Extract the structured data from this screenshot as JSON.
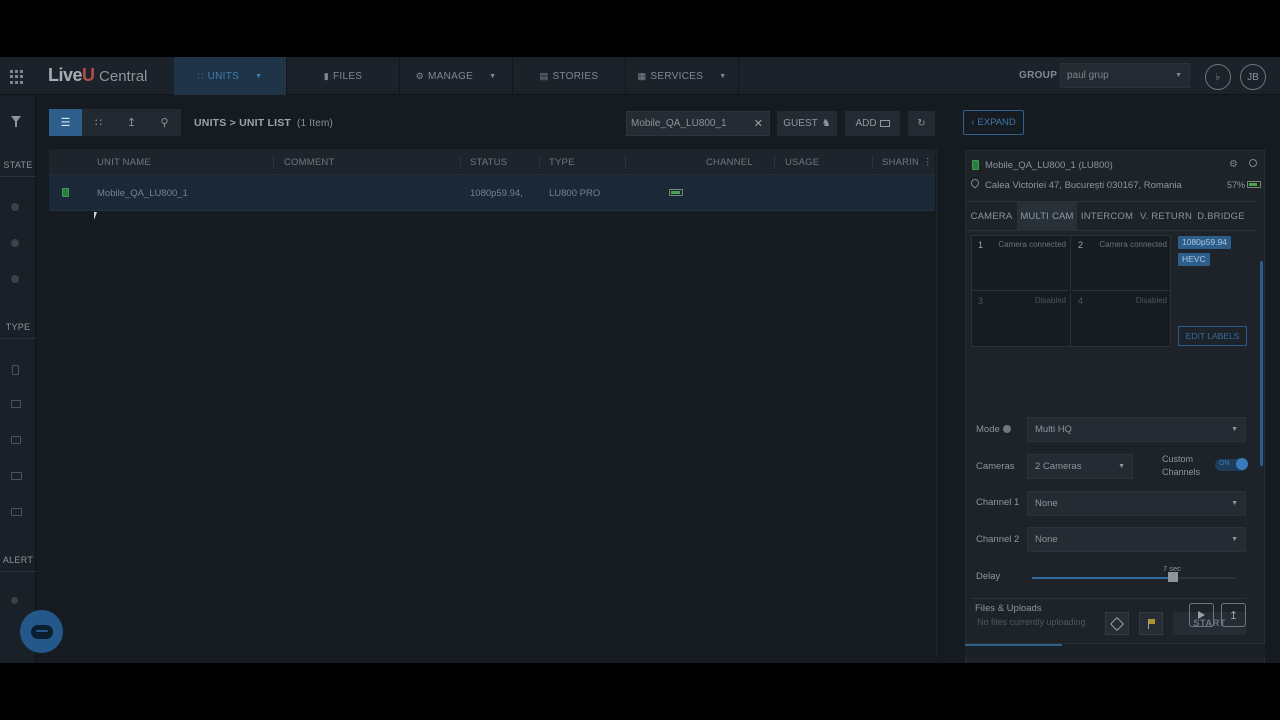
{
  "nav": {
    "logo_live": "Live",
    "logo_u": "U",
    "logo_central": "Central",
    "tabs": [
      {
        "label": "UNITS",
        "icon": "grid-icon"
      },
      {
        "label": "FILES",
        "icon": "file-icon"
      },
      {
        "label": "MANAGE",
        "icon": "gear-icon"
      },
      {
        "label": "STORIES",
        "icon": "stories-icon"
      },
      {
        "label": "SERVICES",
        "icon": "services-icon"
      }
    ],
    "group_label": "GROUP",
    "group_value": "paul grup",
    "user_initials": "JB"
  },
  "rail": {
    "state_label": "STATE",
    "type_label": "TYPE",
    "alert_label": "ALERT"
  },
  "toolbar": {
    "breadcrumb": "UNITS > UNIT LIST",
    "count": "(1 Item)",
    "search_value": "Mobile_QA_LU800_1",
    "guest_label": "GUEST",
    "add_label": "ADD"
  },
  "table": {
    "columns": [
      "UNIT NAME",
      "COMMENT",
      "STATUS",
      "TYPE",
      "CHANNEL",
      "USAGE",
      "SHARING"
    ],
    "rows": [
      {
        "name": "Mobile_QA_LU800_1",
        "comment": "",
        "status": "1080p59.94,",
        "type": "LU800 PRO"
      }
    ]
  },
  "panel": {
    "expand_label": "EXPAND",
    "unit_title": "Mobile_QA_LU800_1 (LU800)",
    "address": "Calea Victoriei 47, București 030167, Romania",
    "battery": "57%",
    "tabs": [
      "CAMERA",
      "MULTI CAM",
      "INTERCOM",
      "V. RETURN",
      "D.BRIDGE"
    ],
    "cams": [
      {
        "num": "1",
        "status": "Camera connected"
      },
      {
        "num": "2",
        "status": "Camera connected"
      },
      {
        "num": "3",
        "status": "Disabled"
      },
      {
        "num": "4",
        "status": "Disabled"
      }
    ],
    "tag_resolution": "1080p59.94",
    "tag_codec": "HEVC",
    "edit_labels": "EDIT LABELS",
    "mode_label": "Mode",
    "mode_value": "Multi HQ",
    "cameras_label": "Cameras",
    "cameras_value": "2 Cameras",
    "custom_channels_label": "Custom Channels",
    "toggle_on": "ON",
    "channel1_label": "Channel 1",
    "channel1_value": "None",
    "channel2_label": "Channel 2",
    "channel2_value": "None",
    "delay_label": "Delay",
    "delay_value": "7 sec",
    "delay_fraction": 0.69,
    "start_label": "START",
    "files_title": "Files & Uploads",
    "files_sub": "No files currently uploading"
  }
}
